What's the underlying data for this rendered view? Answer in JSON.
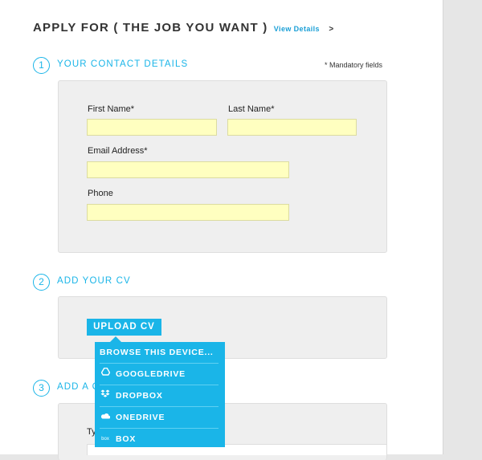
{
  "header": {
    "title": "APPLY FOR ( THE JOB YOU WANT )",
    "view_details": "View Details",
    "chevron": ">"
  },
  "steps": {
    "contact": {
      "number": "1",
      "title": "YOUR CONTACT DETAILS",
      "mandatory_note": "* Mandatory fields"
    },
    "cv": {
      "number": "2",
      "title": "ADD YOUR CV"
    },
    "third": {
      "number": "3",
      "title": "ADD A C"
    }
  },
  "form": {
    "first_name_label": "First Name*",
    "first_name_value": "",
    "last_name_label": "Last Name*",
    "last_name_value": "",
    "email_label": "Email Address*",
    "email_value": "",
    "phone_label": "Phone",
    "phone_value": ""
  },
  "upload": {
    "button_label": "UPLOAD CV",
    "menu": [
      {
        "label": "BROWSE THIS DEVICE...",
        "icon": ""
      },
      {
        "label": "GOOGLEDRIVE",
        "icon": "googledrive-icon"
      },
      {
        "label": "DROPBOX",
        "icon": "dropbox-icon"
      },
      {
        "label": "ONEDRIVE",
        "icon": "onedrive-icon"
      },
      {
        "label": "BOX",
        "icon": "box-icon",
        "icon_text": "box"
      }
    ]
  },
  "third_section": {
    "partial_label": "Ty"
  },
  "colors": {
    "accent": "#1ab5e8",
    "field_bg": "#ffffc0",
    "panel_bg": "#efefef"
  }
}
